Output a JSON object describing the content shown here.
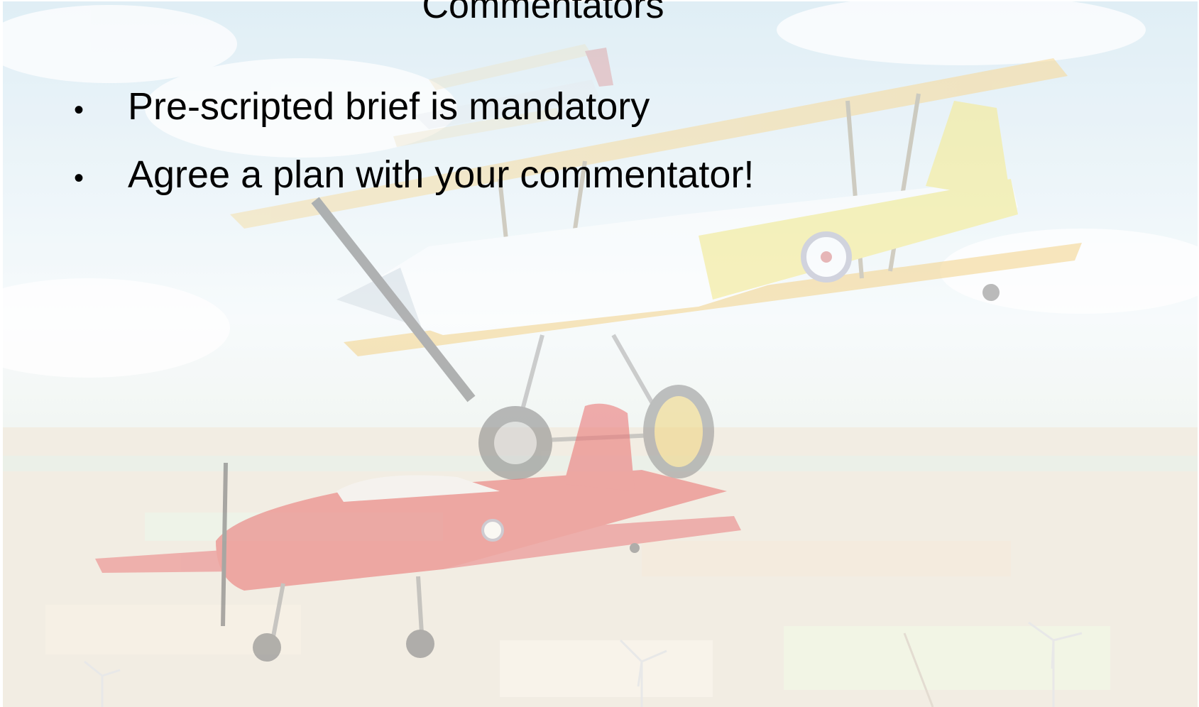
{
  "slide": {
    "title": "Commentators",
    "bullet_glyph": "•",
    "bullets": [
      "Pre-scripted brief is mandatory",
      "Agree a plan with your commentator!"
    ]
  },
  "background": {
    "image": "faded-photo-of-biplane-and-red-monoplane-in-formation-over-farmland",
    "colors": {
      "sky": "#eaf3f8",
      "yellow_biplane": "#f3dc6e",
      "red_plane": "#ee8b8b",
      "fields": "#ede4d6"
    }
  }
}
